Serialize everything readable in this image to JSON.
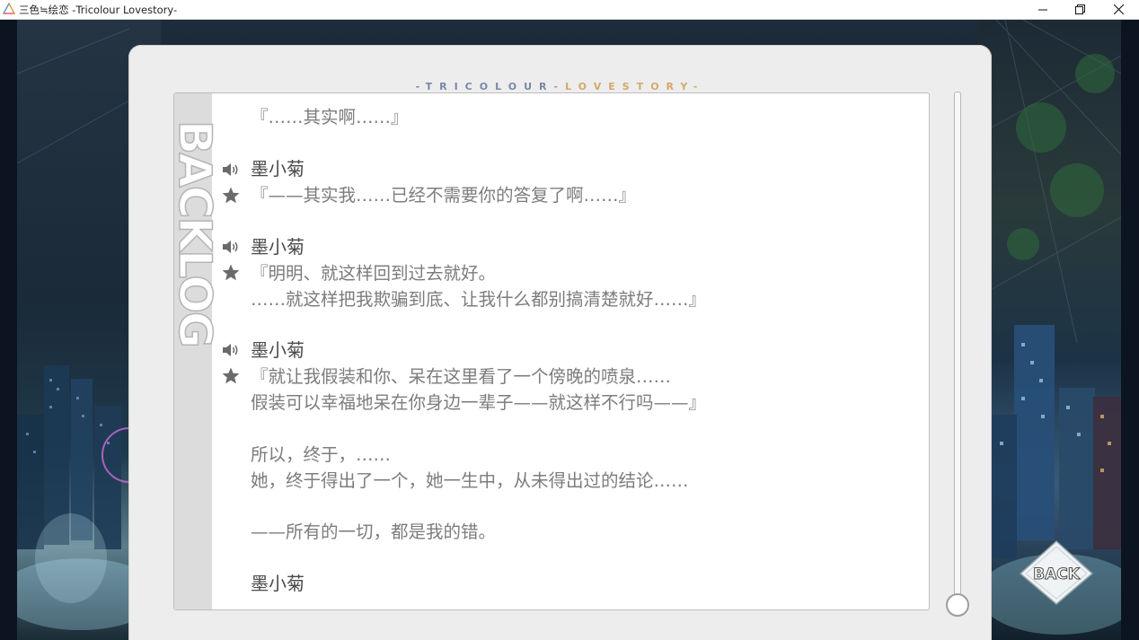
{
  "window": {
    "title": "三色≒绘恋 -Tricolour Lovestory-",
    "app_icon": "triangle-icon",
    "controls": [
      "minimize-icon",
      "restore-icon",
      "close-icon"
    ]
  },
  "panel": {
    "brand_left": "-TRICOLOUR",
    "brand_sep": "-",
    "brand_right": "LOVESTORY-",
    "section_label": "BACKLOG"
  },
  "backlog": {
    "entries": [
      {
        "speaker": "",
        "lines": [
          "『……其实啊……』"
        ]
      },
      {
        "speaker": "墨小菊",
        "lines": [
          "『——其实我……已经不需要你的答复了啊……』"
        ]
      },
      {
        "speaker": "墨小菊",
        "lines": [
          "『明明、就这样回到过去就好。",
          "……就这样把我欺骗到底、让我什么都别搞清楚就好……』"
        ]
      },
      {
        "speaker": "墨小菊",
        "lines": [
          "『就让我假装和你、呆在这里看了一个傍晚的喷泉……",
          "假装可以幸福地呆在你身边一辈子——就这样不行吗——』"
        ]
      },
      {
        "speaker": "",
        "lines": [
          "所以，终于，……",
          "她，终于得出了一个，她一生中，从未得出过的结论……"
        ]
      },
      {
        "speaker": "",
        "lines": [
          "——所有的一切，都是我的错。"
        ]
      },
      {
        "speaker": "墨小菊",
        "lines": []
      }
    ]
  },
  "buttons": {
    "back_label": "BACK"
  },
  "icons": {
    "voice": "speaker-icon",
    "favorite": "star-icon"
  },
  "colors": {
    "panel_bg": "#ededed",
    "text_gray": "#7c7c7c",
    "speaker_text": "#4a4a4a",
    "brand_blue": "#7a88a8",
    "brand_gold": "#d4a86a"
  }
}
